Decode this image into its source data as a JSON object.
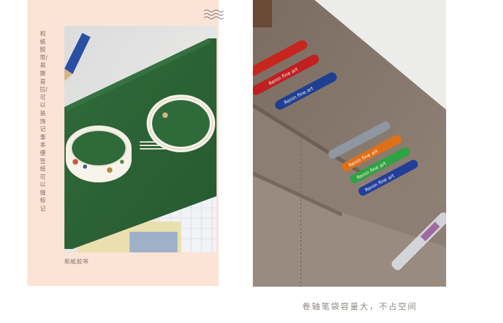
{
  "left_panel": {
    "vertical_text": "和紙胶带/ 易撕易拉/ 可以装饰记事本 便签纸可以做标记",
    "caption": "和紙胶带"
  },
  "right_panel": {
    "marker_brand_text": "Renin fine art"
  },
  "footer": {
    "text": "卷轴笔袋容量大，不占空间"
  },
  "colors": {
    "peach_background": "#fbe3d6",
    "notebook_green": "#2e6a3a",
    "canvas_brown": "#8a7a6e",
    "text_gray": "#7c6f66"
  }
}
